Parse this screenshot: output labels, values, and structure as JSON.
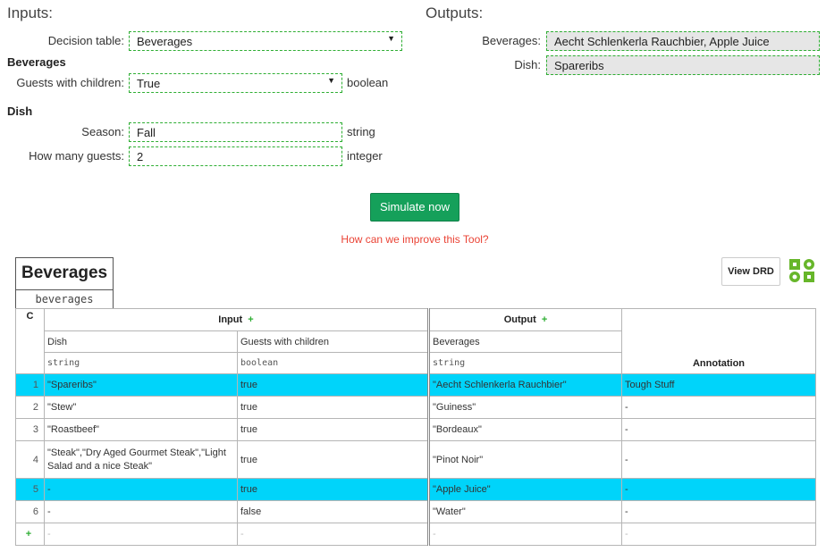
{
  "inputs": {
    "heading": "Inputs:",
    "decision_table_label": "Decision table:",
    "decision_table_value": "Beverages",
    "group1_title": "Beverages",
    "guests_label": "Guests with children:",
    "guests_value": "True",
    "guests_type": "boolean",
    "group2_title": "Dish",
    "season_label": "Season:",
    "season_value": "Fall",
    "season_type": "string",
    "howmany_label": "How many guests:",
    "howmany_value": "2",
    "howmany_type": "integer"
  },
  "outputs": {
    "heading": "Outputs:",
    "beverages_label": "Beverages:",
    "beverages_value": "Aecht Schlenkerla Rauchbier, Apple Juice",
    "dish_label": "Dish:",
    "dish_value": "Spareribs"
  },
  "actions": {
    "simulate_label": "Simulate now",
    "improve_link": "How can we improve this Tool?",
    "view_drd_label": "View DRD"
  },
  "decision_table": {
    "name": "Beverages",
    "id": "beverages",
    "hit_policy": "C",
    "input_group_label": "Input",
    "output_group_label": "Output",
    "add_symbol": "+",
    "annotation_label": "Annotation",
    "columns": [
      {
        "label": "Dish",
        "type": "string"
      },
      {
        "label": "Guests with children",
        "type": "boolean"
      },
      {
        "label": "Beverages",
        "type": "string"
      }
    ],
    "rows": [
      {
        "n": "1",
        "dish": "\"Spareribs\"",
        "guests": "true",
        "bev": "\"Aecht Schlenkerla Rauchbier\"",
        "annotation": "Tough Stuff",
        "highlight": true
      },
      {
        "n": "2",
        "dish": "\"Stew\"",
        "guests": "true",
        "bev": "\"Guiness\"",
        "annotation": "-",
        "highlight": false
      },
      {
        "n": "3",
        "dish": "\"Roastbeef\"",
        "guests": "true",
        "bev": "\"Bordeaux\"",
        "annotation": "-",
        "highlight": false
      },
      {
        "n": "4",
        "dish": "\"Steak\",\"Dry Aged Gourmet Steak\",\"Light Salad and a nice Steak\"",
        "guests": "true",
        "bev": "\"Pinot Noir\"",
        "annotation": "-",
        "highlight": false
      },
      {
        "n": "5",
        "dish": "-",
        "guests": "true",
        "bev": "\"Apple Juice\"",
        "annotation": "-",
        "highlight": true
      },
      {
        "n": "6",
        "dish": "-",
        "guests": "false",
        "bev": "\"Water\"",
        "annotation": "-",
        "highlight": false
      }
    ],
    "new_row_placeholder": "-"
  },
  "colors": {
    "accent_green": "#15a05a",
    "highlight_cyan": "#00d4fa",
    "field_border": "#2eae33",
    "link_red": "#ea4335"
  },
  "icons": {
    "drd_logo": "drd-gear-icon",
    "select_caret": "caret-down-icon"
  }
}
